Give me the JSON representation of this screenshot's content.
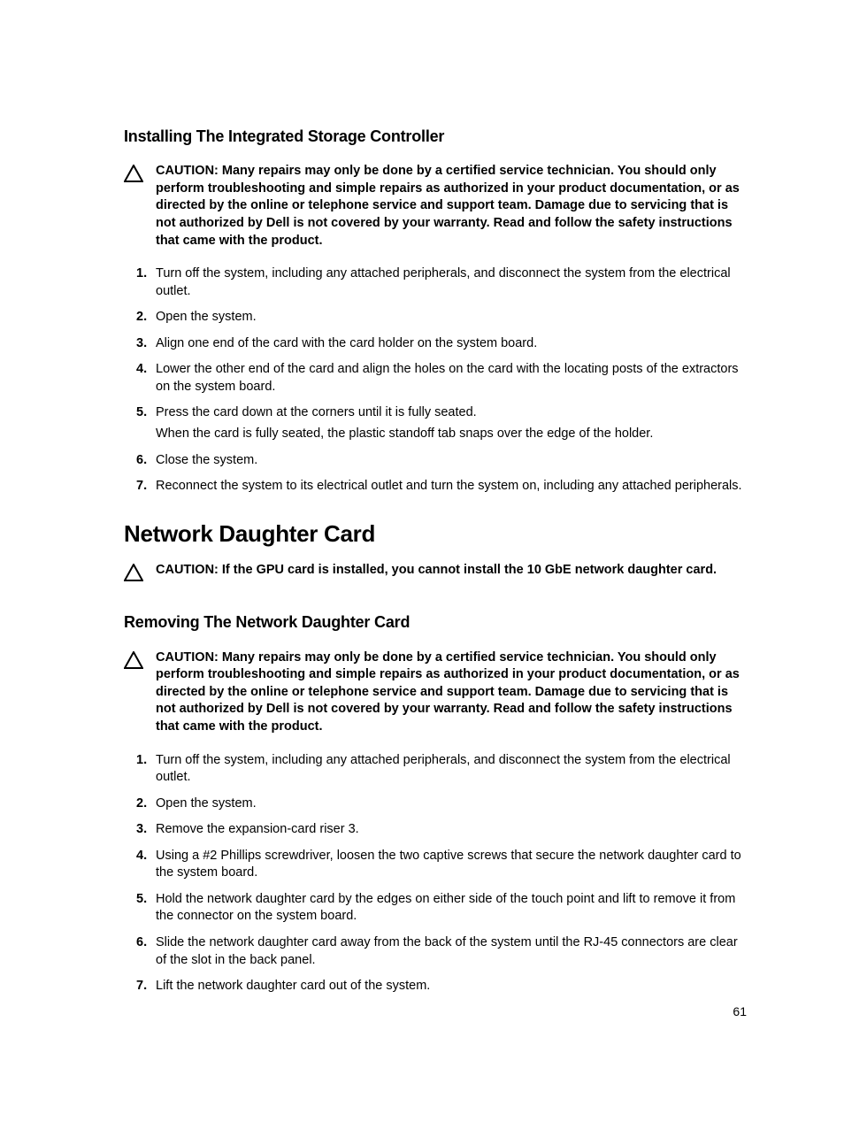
{
  "pageNumber": "61",
  "section1": {
    "heading": "Installing The Integrated Storage Controller",
    "caution": "CAUTION: Many repairs may only be done by a certified service technician. You should only perform troubleshooting and simple repairs as authorized in your product documentation, or as directed by the online or telephone service and support team. Damage due to servicing that is not authorized by Dell is not covered by your warranty. Read and follow the safety instructions that came with the product.",
    "steps": [
      {
        "n": "1.",
        "t": "Turn off the system, including any attached peripherals, and disconnect the system from the electrical outlet."
      },
      {
        "n": "2.",
        "t": "Open the system."
      },
      {
        "n": "3.",
        "t": "Align one end of the card with the card holder on the system board."
      },
      {
        "n": "4.",
        "t": "Lower the other end of the card and align the holes on the card with the locating posts of the extractors on the system board."
      },
      {
        "n": "5.",
        "t": "Press the card down at the corners until it is fully seated.",
        "t2": "When the card is fully seated, the plastic standoff tab snaps over the edge of the holder."
      },
      {
        "n": "6.",
        "t": "Close the system."
      },
      {
        "n": "7.",
        "t": "Reconnect the system to its electrical outlet and turn the system on, including any attached peripherals."
      }
    ]
  },
  "section2": {
    "heading": "Network Daughter Card",
    "caution": "CAUTION: If the GPU card is installed, you cannot install the 10 GbE network daughter card."
  },
  "section3": {
    "heading": "Removing The Network Daughter Card",
    "caution": "CAUTION: Many repairs may only be done by a certified service technician. You should only perform troubleshooting and simple repairs as authorized in your product documentation, or as directed by the online or telephone service and support team. Damage due to servicing that is not authorized by Dell is not covered by your warranty. Read and follow the safety instructions that came with the product.",
    "steps": [
      {
        "n": "1.",
        "t": "Turn off the system, including any attached peripherals, and disconnect the system from the electrical outlet."
      },
      {
        "n": "2.",
        "t": "Open the system."
      },
      {
        "n": "3.",
        "t": "Remove the expansion-card riser 3."
      },
      {
        "n": "4.",
        "t": "Using a #2 Phillips screwdriver, loosen the two captive screws that secure the network daughter card to the system board."
      },
      {
        "n": "5.",
        "t": "Hold the network daughter card by the edges on either side of the touch point and lift to remove it from the connector on the system board."
      },
      {
        "n": "6.",
        "t": "Slide the network daughter card away from the back of the system until the RJ-45 connectors are clear of the slot in the back panel."
      },
      {
        "n": "7.",
        "t": "Lift the network daughter card out of the system."
      }
    ]
  }
}
